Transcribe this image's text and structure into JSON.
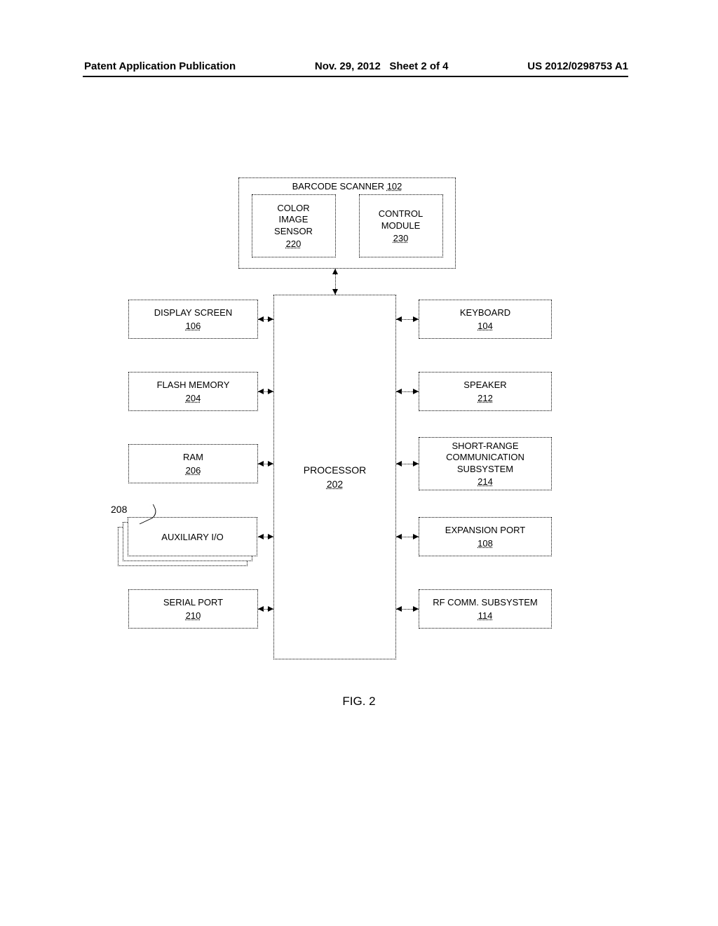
{
  "header": {
    "pub_type": "Patent Application Publication",
    "date": "Nov. 29, 2012",
    "sheet": "Sheet 2 of 4",
    "pub_number": "US 2012/0298753 A1"
  },
  "figure_label": "FIG. 2",
  "scanner": {
    "title": "BARCODE SCANNER",
    "ref": "102",
    "color_image_sensor": {
      "label": "COLOR\nIMAGE\nSENSOR",
      "ref": "220"
    },
    "control_module": {
      "label": "CONTROL\nMODULE",
      "ref": "230"
    }
  },
  "processor": {
    "label": "PROCESSOR",
    "ref": "202"
  },
  "left": {
    "display": {
      "label": "DISPLAY SCREEN",
      "ref": "106"
    },
    "flash": {
      "label": "FLASH MEMORY",
      "ref": "204"
    },
    "ram": {
      "label": "RAM",
      "ref": "206"
    },
    "aux": {
      "label": "AUXILIARY I/O",
      "ref": "208"
    },
    "serial": {
      "label": "SERIAL PORT",
      "ref": "210"
    }
  },
  "right": {
    "keyboard": {
      "label": "KEYBOARD",
      "ref": "104"
    },
    "speaker": {
      "label": "SPEAKER",
      "ref": "212"
    },
    "shortrange": {
      "label": "SHORT-RANGE\nCOMMUNICATION\nSUBSYSTEM",
      "ref": "214"
    },
    "expansion": {
      "label": "EXPANSION PORT",
      "ref": "108"
    },
    "rfcomm": {
      "label": "RF COMM. SUBSYSTEM",
      "ref": "114"
    }
  },
  "callout_208": "208"
}
